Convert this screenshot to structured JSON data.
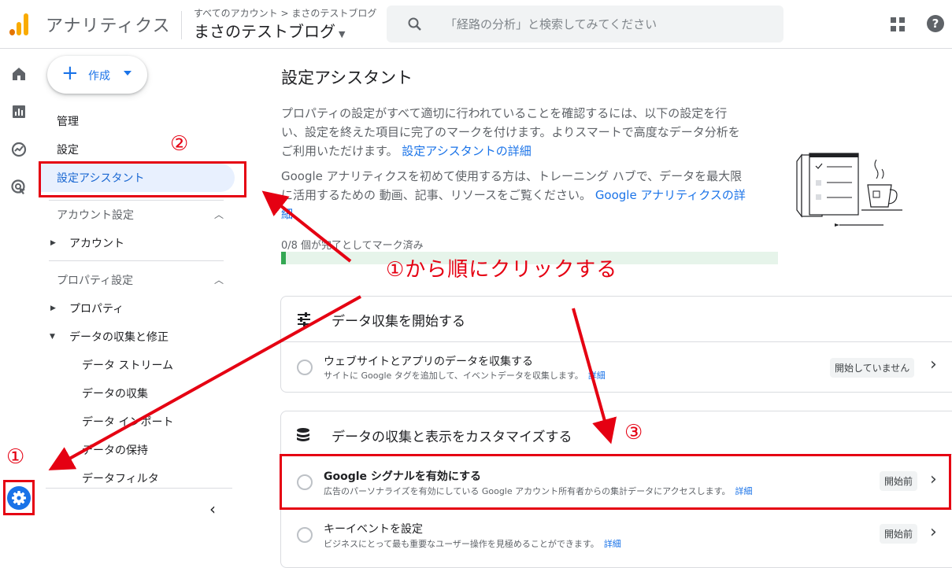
{
  "header": {
    "app_name": "アナリティクス",
    "breadcrumb": "すべてのアカウント > まさのテストブログ",
    "property_name": "まさのテストブログ",
    "search_placeholder": "「経路の分析」と検索してみてください"
  },
  "nav": {
    "create_label": "作成",
    "items_top": [
      "管理",
      "設定",
      "設定アシスタント"
    ],
    "account_section": "アカウント設定",
    "account_item": "アカウント",
    "property_section": "プロパティ設定",
    "property_item": "プロパティ",
    "data_collection_group": "データの収集と修正",
    "sub_items": [
      "データ ストリーム",
      "データの収集",
      "データ インポート",
      "データの保持",
      "データフィルタ"
    ]
  },
  "main": {
    "title": "設定アシスタント",
    "desc1_lines": [
      "プロパティの設定がすべて適切に行われていることを確認するには、以下の設定を行",
      "い、設定を終えた項目に完了のマークを付けます。よりスマートで高度なデータ分析を"
    ],
    "desc1_line3": "ご利用いただけます。",
    "desc1_link": "設定アシスタントの詳細",
    "desc2_lines": [
      "Google アナリティクスを初めて使用する方は、トレーニング ハブで、データを最大限"
    ],
    "desc2_line2": "に活用するための 動画、記事、リソースをご覧ください。",
    "desc2_link_a": "Google アナリティクスの詳",
    "desc2_link_b": "細",
    "progress_label": "0/8 個が完了としてマーク済み",
    "progress": {
      "done": 0,
      "total": 8
    },
    "cards": [
      {
        "title": "データ収集を開始する",
        "tasks": [
          {
            "title": "ウェブサイトとアプリのデータを収集する",
            "sub": "サイトに Google タグを追加して、イベントデータを収集します。",
            "link": "詳細",
            "status": "開始していません"
          }
        ]
      },
      {
        "title": "データの収集と表示をカスタマイズする",
        "tasks": [
          {
            "title": "Google シグナルを有効にする",
            "sub": "広告のパーソナライズを有効にしている Google アカウント所有者からの集計データにアクセスします。",
            "link": "詳細",
            "status": "開始前"
          },
          {
            "title": "キーイベントを設定",
            "sub": "ビジネスにとって最も重要なユーザー操作を見極めることができます。",
            "link": "詳細",
            "status": "開始前"
          }
        ]
      }
    ]
  },
  "annotations": {
    "num1": "①",
    "num2": "②",
    "num3": "③",
    "instruction": "①から順にクリックする",
    "color": "#e50012"
  }
}
